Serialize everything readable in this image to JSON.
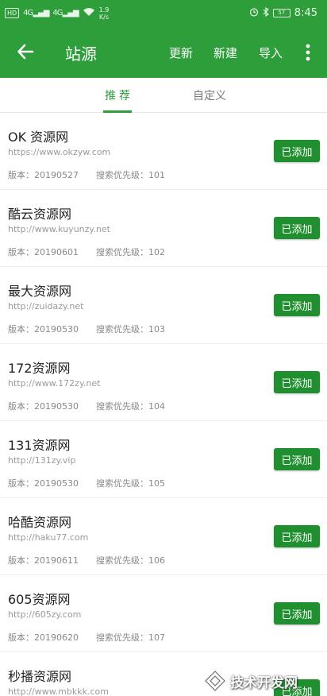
{
  "status_bar": {
    "hd": "HD",
    "sig1": "4G",
    "sig2": "4G",
    "speed_value": "1.9",
    "speed_unit": "K/s",
    "battery": "57",
    "time": "8:45"
  },
  "toolbar": {
    "back_icon": "arrow-left-icon",
    "title": "站源",
    "actions": [
      "更新",
      "新建",
      "导入"
    ],
    "more_icon": "more-vertical-icon"
  },
  "tabs": [
    "推荐",
    "自定义"
  ],
  "active_tab": 0,
  "colors": {
    "primary": "#2e9e3a",
    "button": "#1f8f2f"
  },
  "sources": [
    {
      "name": "OK 资源网",
      "url": "https://www.okzyw.com",
      "version_label": "版本：20190527",
      "priority_label": "搜索优先级：101",
      "button": "已添加"
    },
    {
      "name": "酷云资源网",
      "url": "http://www.kuyunzy.net",
      "version_label": "版本：20190601",
      "priority_label": "搜索优先级：102",
      "button": "已添加"
    },
    {
      "name": "最大资源网",
      "url": "http://zuidazy.net",
      "version_label": "版本：20190530",
      "priority_label": "搜索优先级：103",
      "button": "已添加"
    },
    {
      "name": "172资源网",
      "url": "http://www.172zy.net",
      "version_label": "版本：20190530",
      "priority_label": "搜索优先级：104",
      "button": "已添加"
    },
    {
      "name": "131资源网",
      "url": "http://131zy.vip",
      "version_label": "版本：20190530",
      "priority_label": "搜索优先级：105",
      "button": "已添加"
    },
    {
      "name": "哈酷资源网",
      "url": "http://haku77.com",
      "version_label": "版本：20190611",
      "priority_label": "搜索优先级：106",
      "button": "已添加"
    },
    {
      "name": "605资源网",
      "url": "http://605zy.com",
      "version_label": "版本：20190620",
      "priority_label": "搜索优先级：107",
      "button": "已添加"
    },
    {
      "name": "秒播资源网",
      "url": "http://www.mbkkk.com",
      "version_label": "",
      "priority_label": "",
      "button": "已添加"
    }
  ],
  "watermark": "技术开发网"
}
